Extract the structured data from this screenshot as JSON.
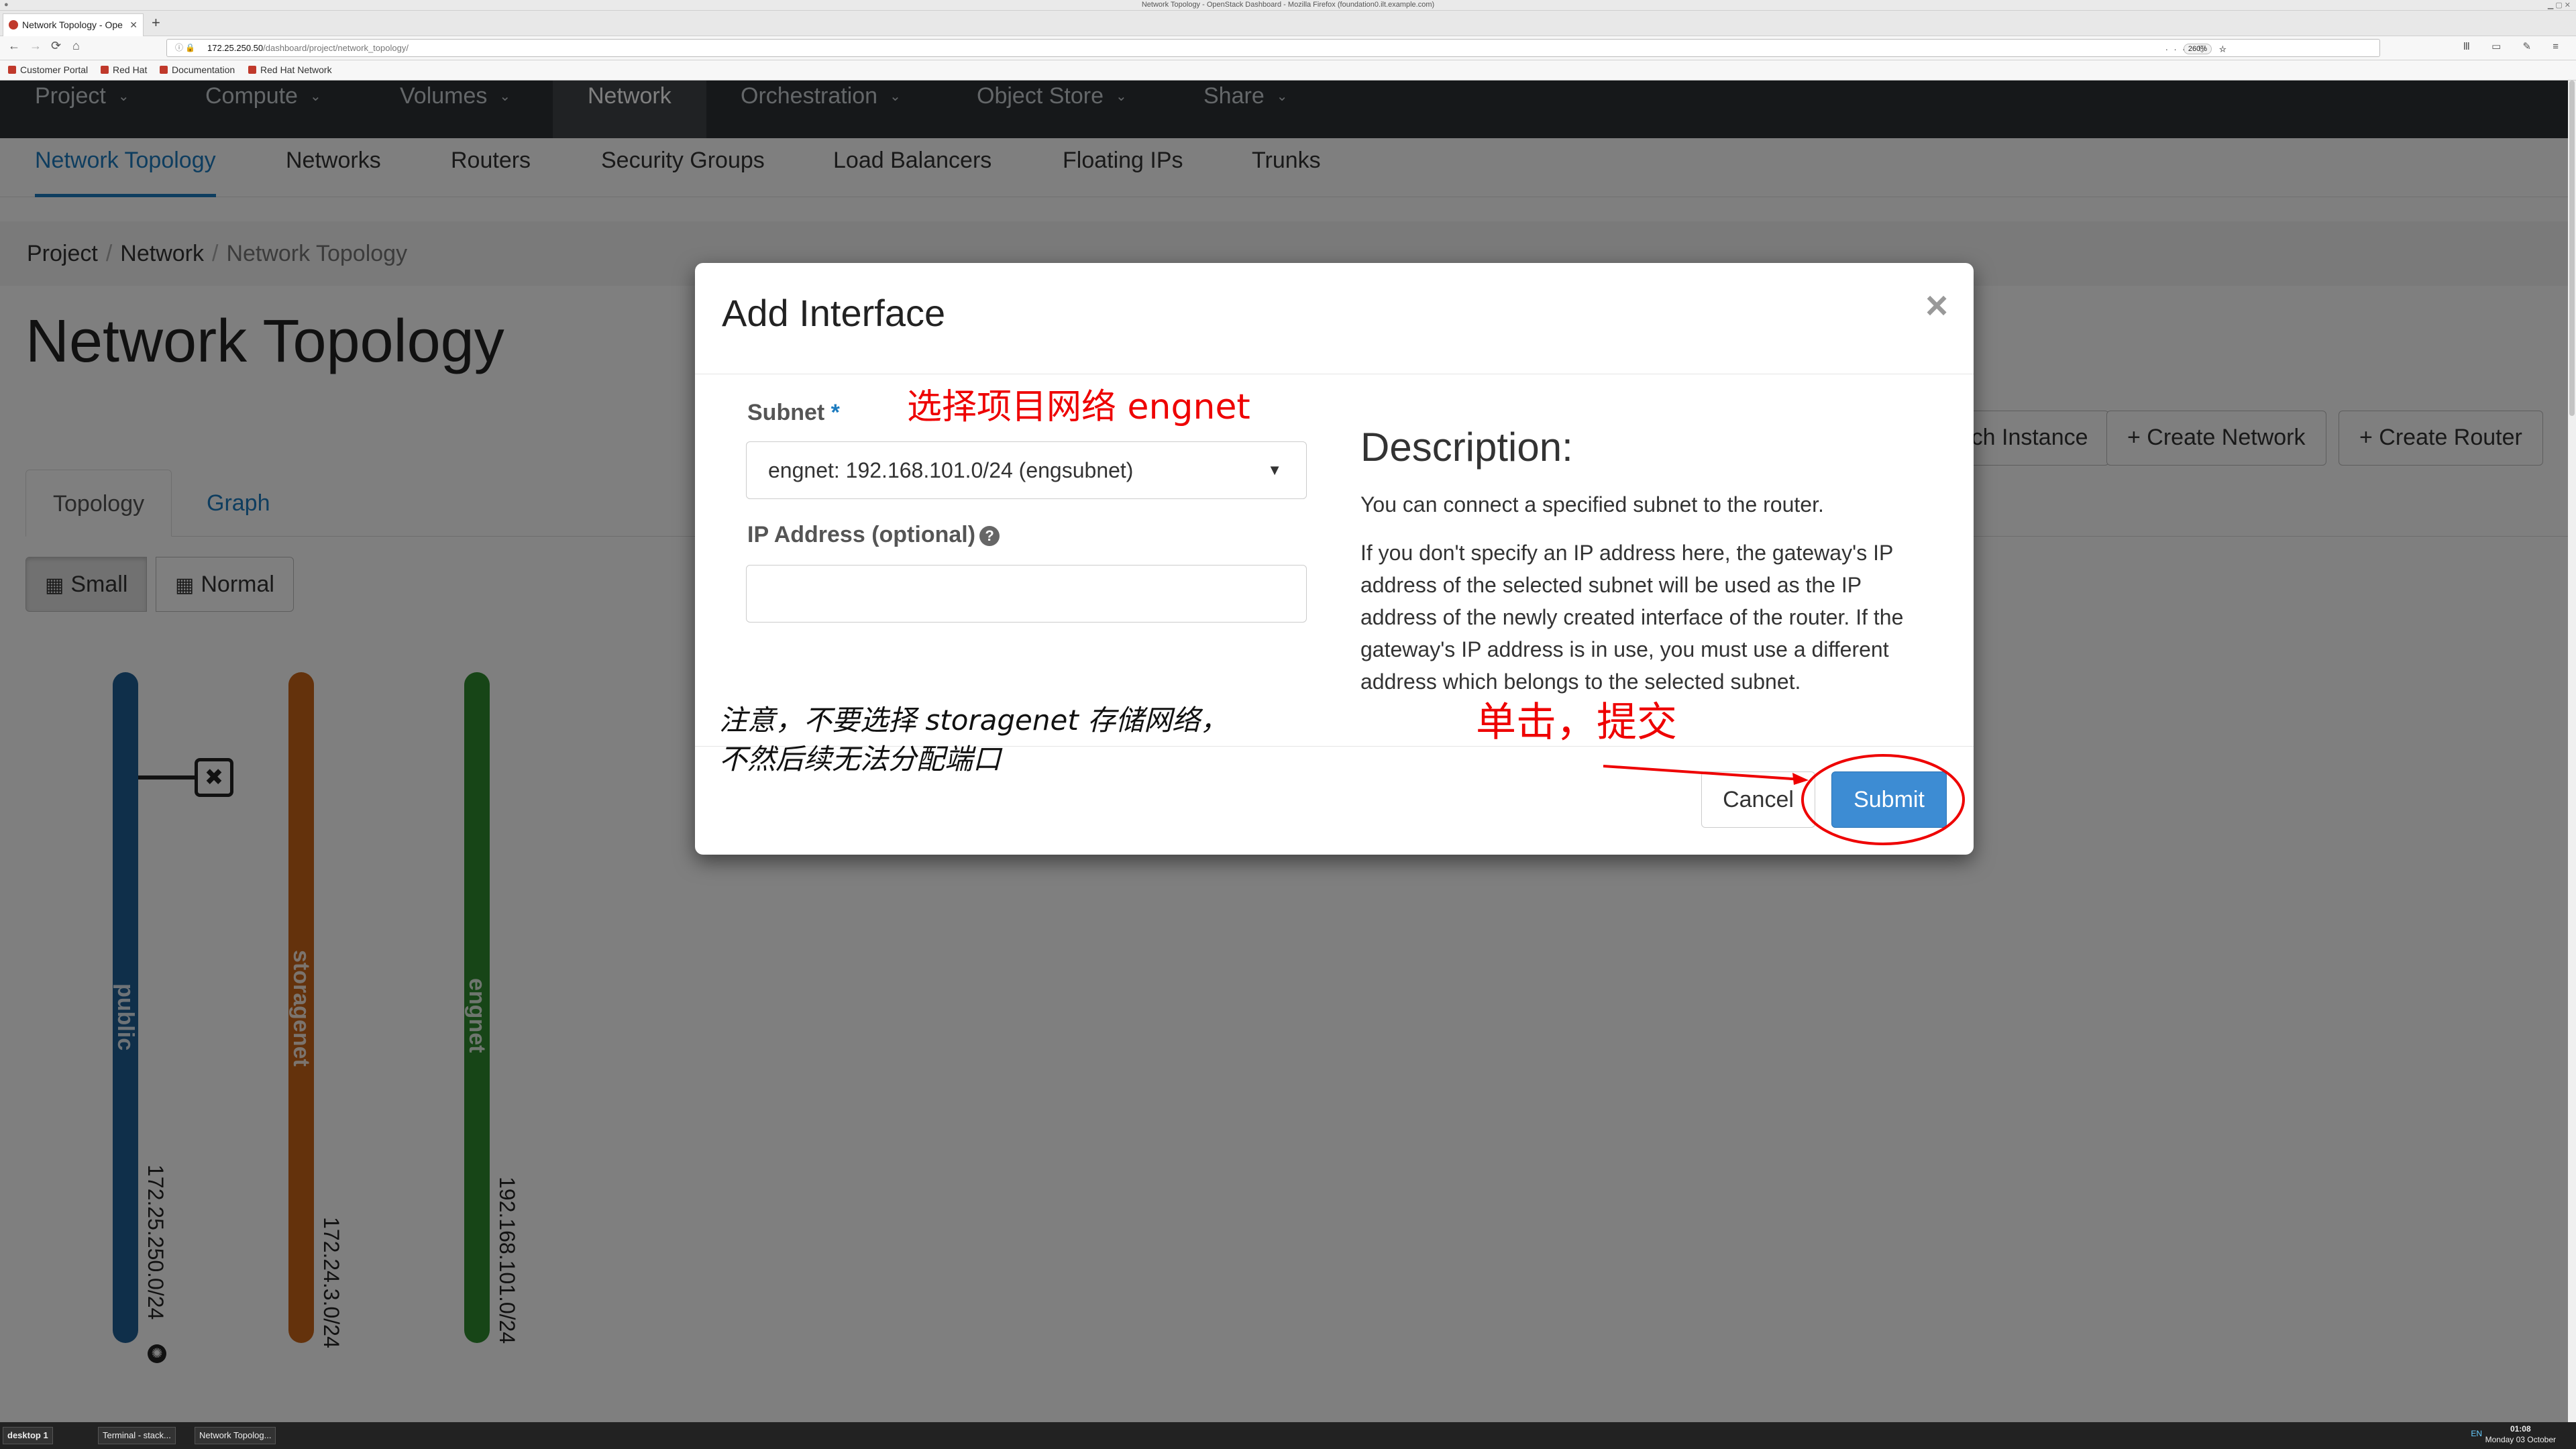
{
  "window": {
    "title": "Network Topology - OpenStack Dashboard - Mozilla Firefox (foundation0.ilt.example.com)"
  },
  "browser": {
    "tab_title": "Network Topology - Ope",
    "url_host": "172.25.250.50",
    "url_path": "/dashboard/project/network_topology/",
    "zoom": "260%",
    "bookmarks": [
      "Customer Portal",
      "Red Hat",
      "Documentation",
      "Red Hat Network"
    ]
  },
  "topnav": {
    "items": [
      {
        "label": "Project",
        "caret": true
      },
      {
        "label": "Compute",
        "caret": true
      },
      {
        "label": "Volumes",
        "caret": true
      },
      {
        "label": "Network",
        "caret": false,
        "active": true
      },
      {
        "label": "Orchestration",
        "caret": true
      },
      {
        "label": "Object Store",
        "caret": true
      },
      {
        "label": "Share",
        "caret": true
      }
    ]
  },
  "subnav": {
    "items": [
      {
        "label": "Network Topology",
        "active": true
      },
      {
        "label": "Networks"
      },
      {
        "label": "Routers"
      },
      {
        "label": "Security Groups"
      },
      {
        "label": "Load Balancers"
      },
      {
        "label": "Floating IPs"
      },
      {
        "label": "Trunks"
      }
    ]
  },
  "breadcrumb": {
    "items": [
      "Project",
      "Network"
    ],
    "current": "Network Topology"
  },
  "page": {
    "title": "Network Topology",
    "actions": [
      "Launch Instance",
      "+ Create Network",
      "+ Create Router"
    ],
    "tabs": [
      "Topology",
      "Graph"
    ],
    "size_buttons": [
      "Small",
      "Normal"
    ]
  },
  "topology": {
    "networks": [
      {
        "name": "public",
        "cidr": "172.25.250.0/24",
        "color": "#1f5f95"
      },
      {
        "name": "storagenet",
        "cidr": "172.24.3.0/24",
        "color": "#c96518"
      },
      {
        "name": "engnet",
        "cidr": "192.168.101.0/24",
        "color": "#2e8b2e"
      }
    ]
  },
  "modal": {
    "title": "Add Interface",
    "close": "×",
    "subnet_label": "Subnet",
    "required_mark": "*",
    "subnet_value": "engnet: 192.168.101.0/24 (engsubnet)",
    "ip_label": "IP Address (optional)",
    "ip_value": "",
    "desc_title": "Description:",
    "desc_p1": "You can connect a specified subnet to the router.",
    "desc_p2": "If you don't specify an IP address here, the gateway's IP address of the selected subnet will be used as the IP address of the newly created interface of the router. If the gateway's IP address is in use, you must use a different address which belongs to the selected subnet.",
    "cancel": "Cancel",
    "submit": "Submit"
  },
  "annotations": {
    "select_subnet": "选择项目网络 engnet",
    "warning_line1": "注意，不要选择 storagenet 存储网络，",
    "warning_line2": "不然后续无法分配端口",
    "click_submit": "单击，提交"
  },
  "taskbar": {
    "items": [
      "desktop 1",
      "Terminal - stack...",
      "Network Topolog..."
    ],
    "lang": "EN",
    "time": "01:08",
    "date": "Monday 03 October"
  }
}
